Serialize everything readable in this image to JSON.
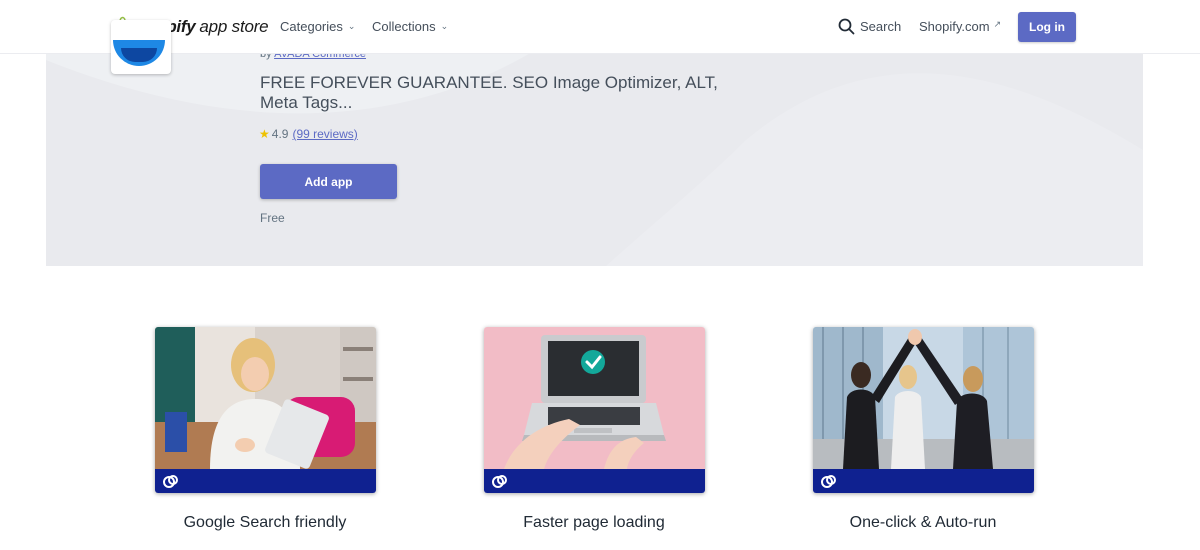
{
  "header": {
    "logo_brand": "shopify",
    "logo_suffix": "app store",
    "nav": [
      {
        "label": "Categories"
      },
      {
        "label": "Collections"
      }
    ],
    "search_label": "Search",
    "shopify_link": "Shopify.com",
    "login_label": "Log in",
    "icons": {
      "search": "search-icon",
      "chevron": "chevron-down-icon",
      "external": "external-link-icon",
      "logo": "shopify-bag-icon"
    }
  },
  "app": {
    "byline_prefix": "by",
    "developer": "AVADA Commerce",
    "tagline": "FREE FOREVER GUARANTEE. SEO Image Optimizer, ALT, Meta Tags...",
    "rating": "4.9",
    "reviews": "(99 reviews)",
    "add_button": "Add app",
    "price": "Free"
  },
  "features": [
    {
      "title": "Google Search friendly",
      "image": "woman-with-tablet-photo"
    },
    {
      "title": "Faster page loading",
      "image": "laptop-checkmark-photo"
    },
    {
      "title": "One-click & Auto-run",
      "image": "women-high-five-photo"
    }
  ],
  "colors": {
    "accent": "#5c6ac4",
    "hero_bg": "#ecedf1",
    "card_bar": "#0f2190",
    "star": "#eec200"
  }
}
